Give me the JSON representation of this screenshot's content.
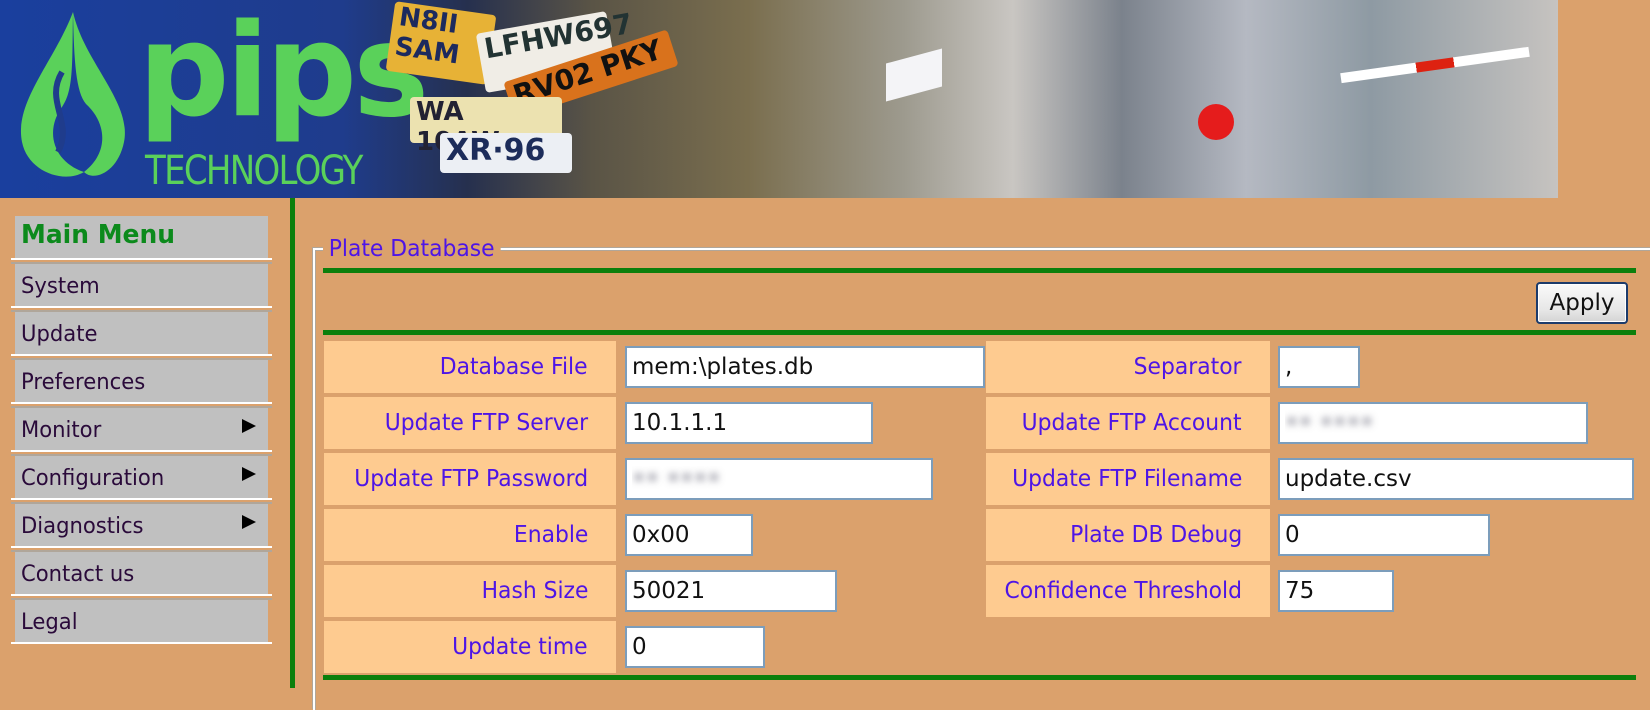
{
  "banner": {
    "logo_text": "pips",
    "logo_subtext": "TECHNOLOGY",
    "plates": [
      "N8II SAM",
      "LFHW697",
      "RV02 PKY",
      "WA 10AW",
      "XR·96"
    ]
  },
  "sidebar": {
    "title": "Main Menu",
    "items": [
      {
        "label": "System",
        "has_submenu": false
      },
      {
        "label": "Update",
        "has_submenu": false
      },
      {
        "label": "Preferences",
        "has_submenu": false
      },
      {
        "label": "Monitor",
        "has_submenu": true
      },
      {
        "label": "Configuration",
        "has_submenu": true
      },
      {
        "label": "Diagnostics",
        "has_submenu": true
      },
      {
        "label": "Contact us",
        "has_submenu": false
      },
      {
        "label": "Legal",
        "has_submenu": false
      }
    ]
  },
  "panel": {
    "title": "Plate Database",
    "apply_label": "Apply",
    "fields": {
      "database_file": {
        "label": "Database File",
        "value": "mem:\\plates.db"
      },
      "separator": {
        "label": "Separator",
        "value": ","
      },
      "update_ftp_server": {
        "label": "Update FTP Server",
        "value": "10.1.1.1"
      },
      "update_ftp_account": {
        "label": "Update FTP Account",
        "value": "•• ••••"
      },
      "update_ftp_password": {
        "label": "Update FTP Password",
        "value": "•• ••••"
      },
      "update_ftp_filename": {
        "label": "Update FTP Filename",
        "value": "update.csv"
      },
      "enable": {
        "label": "Enable",
        "value": "0x00"
      },
      "plate_db_debug": {
        "label": "Plate DB Debug",
        "value": "0"
      },
      "hash_size": {
        "label": "Hash Size",
        "value": "50021"
      },
      "confidence_threshold": {
        "label": "Confidence Threshold",
        "value": "75"
      },
      "update_time": {
        "label": "Update time",
        "value": "0"
      }
    }
  },
  "colors": {
    "page_bg": "#dba16c",
    "accent_green": "#0c7f0c",
    "label_bg": "#fecb90",
    "label_text": "#4e15e6",
    "menu_bg": "#c0c0c0",
    "logo_green": "#5ad15a"
  }
}
